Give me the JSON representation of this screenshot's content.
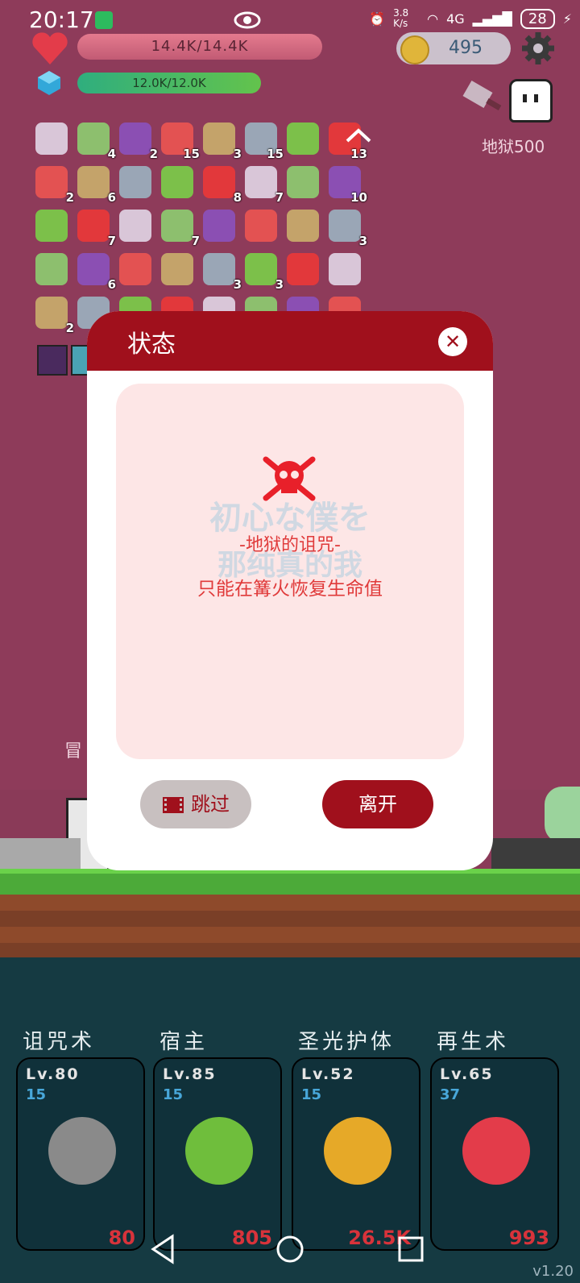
{
  "status_bar": {
    "time": "20:17",
    "net_speed": "3.8 K/s",
    "network": "4G",
    "battery": "28"
  },
  "player": {
    "hp": "14.4K/14.4K",
    "mp": "12.0K/12.0K",
    "coins": "495"
  },
  "location": {
    "label": "地狱500"
  },
  "inventory": {
    "rows": [
      [
        {
          "icon": "scroll-ribbon",
          "count": ""
        },
        {
          "icon": "tablet",
          "count": "4"
        },
        {
          "icon": "purple-potion",
          "count": "2"
        },
        {
          "icon": "watermelon",
          "count": "15"
        },
        {
          "icon": "bow",
          "count": "3"
        },
        {
          "icon": "sword",
          "count": "15"
        },
        {
          "icon": "lime",
          "count": ""
        },
        {
          "icon": "apple",
          "count": "13"
        }
      ],
      [
        {
          "icon": "suitcase",
          "count": "2"
        },
        {
          "icon": "pill",
          "count": "6"
        },
        {
          "icon": "hook",
          "count": ""
        },
        {
          "icon": "wizard-hat",
          "count": ""
        },
        {
          "icon": "speech-bubble",
          "count": "8"
        },
        {
          "icon": "dagger",
          "count": "7"
        },
        {
          "icon": "note",
          "count": ""
        },
        {
          "icon": "book",
          "count": "10"
        }
      ],
      [
        {
          "icon": "ice-cream",
          "count": ""
        },
        {
          "icon": "green-flask",
          "count": "7"
        },
        {
          "icon": "meteors",
          "count": ""
        },
        {
          "icon": "flower",
          "count": "7"
        },
        {
          "icon": "bat",
          "count": ""
        },
        {
          "icon": "unicorn",
          "count": ""
        },
        {
          "icon": "scroll",
          "count": ""
        },
        {
          "icon": "cake",
          "count": "3"
        }
      ],
      [
        {
          "icon": "magic-wand",
          "count": ""
        },
        {
          "icon": "beer",
          "count": "6"
        },
        {
          "icon": "card",
          "count": ""
        },
        {
          "icon": "door",
          "count": ""
        },
        {
          "icon": "capsule",
          "count": "3"
        },
        {
          "icon": "jam-jar",
          "count": "3"
        },
        {
          "icon": "target",
          "count": ""
        },
        {
          "icon": "flames",
          "count": ""
        }
      ],
      [
        {
          "icon": "envelope",
          "count": "2"
        },
        {
          "icon": "id-card",
          "count": ""
        },
        {
          "icon": "parchment",
          "count": ""
        },
        {
          "icon": "shield",
          "count": ""
        },
        {
          "icon": "heart-purple",
          "count": ""
        },
        {
          "icon": "pineapple",
          "count": ""
        },
        {
          "icon": "sunflower",
          "count": ""
        },
        {
          "icon": "blue-blade",
          "count": ""
        }
      ]
    ]
  },
  "world": {
    "partial_label": "冒"
  },
  "dialog": {
    "title": "状态",
    "watermark_line1": "初心な僕を",
    "watermark_line2": "那纯真的我",
    "curse_name": "-地狱的诅咒-",
    "curse_desc": "只能在篝火恢复生命值",
    "skip_label": "跳过",
    "leave_label": "离开"
  },
  "skills": [
    {
      "name": "诅咒术",
      "level": "Lv.80",
      "cost": "15",
      "value": "80",
      "icon": "skull-icon"
    },
    {
      "name": "宿主",
      "level": "Lv.85",
      "cost": "15",
      "value": "805",
      "icon": "monster-icon"
    },
    {
      "name": "圣光护体",
      "level": "Lv.52",
      "cost": "15",
      "value": "26.5K",
      "icon": "angel-icon"
    },
    {
      "name": "再生术",
      "level": "Lv.65",
      "cost": "37",
      "value": "993",
      "icon": "winged-heart-icon"
    }
  ],
  "version": "v1.20",
  "colors": {
    "accent": "#a0101c",
    "background": "#8e3b5a",
    "panel": "#153a42"
  }
}
